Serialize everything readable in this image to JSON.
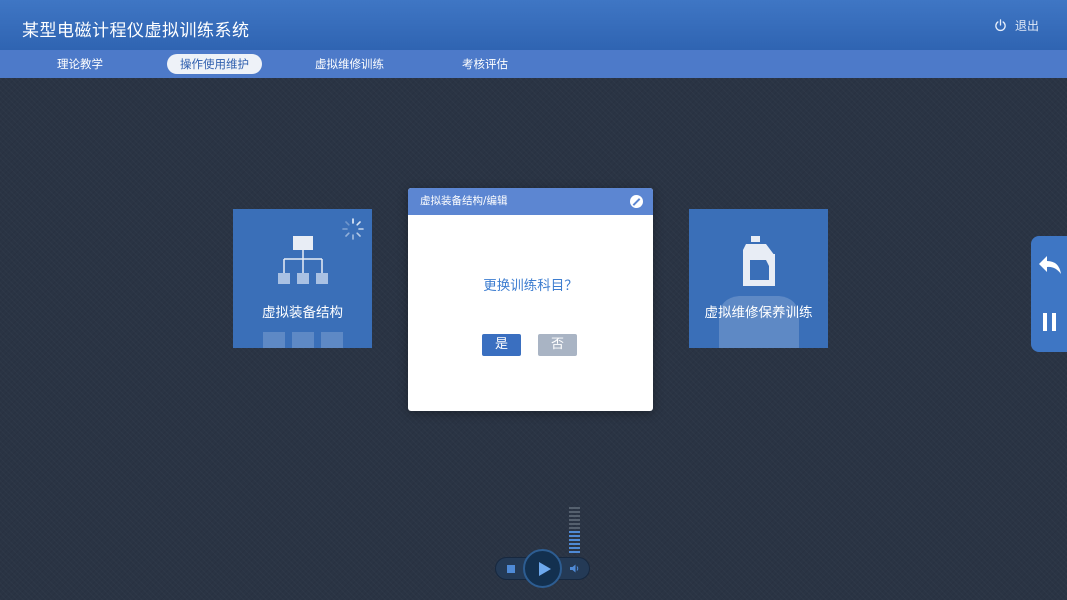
{
  "header": {
    "title": "某型电磁计程仪虚拟训练系统",
    "logout_label": "退出"
  },
  "nav": {
    "tabs": [
      {
        "label": "理论教学",
        "active": false
      },
      {
        "label": "操作使用维护",
        "active": true
      },
      {
        "label": "虚拟维修训练",
        "active": false
      },
      {
        "label": "考核评估",
        "active": false
      }
    ]
  },
  "tiles": {
    "left": {
      "label": "虚拟装备结构",
      "icon": "hierarchy-icon",
      "loading": true
    },
    "right": {
      "label": "虚拟维修保养训练",
      "icon": "oil-bottle-icon"
    }
  },
  "dialog": {
    "title": "虚拟装备结构/编辑",
    "message": "更换训练科目？",
    "yes_label": "是",
    "no_label": "否"
  },
  "side_dock": {
    "buttons": [
      "back-arrow-icon",
      "pause-icon"
    ]
  },
  "player": {
    "state": "paused",
    "volume_level": 0.5
  },
  "colors": {
    "background": "#2a3444",
    "header": "#356bb9",
    "nav": "#4d7ac9",
    "tile": "#3a6fb8",
    "dialog_header": "#5c86d2",
    "message_text": "#3d7dd0",
    "yes_button": "#3a6fc0",
    "no_button": "#a9b4c4"
  }
}
